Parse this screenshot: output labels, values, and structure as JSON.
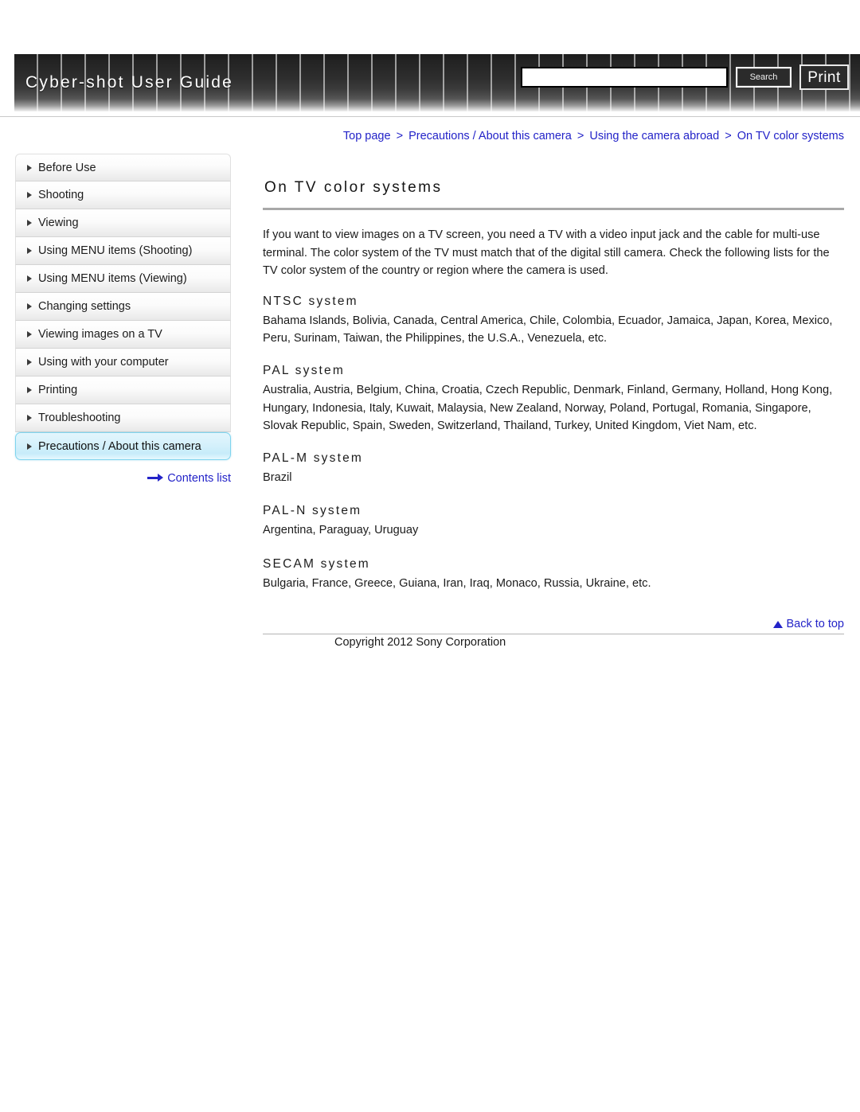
{
  "header": {
    "title": "Cyber-shot User Guide",
    "search": {
      "value": "",
      "placeholder": "",
      "button_label": "Search",
      "icon": "search-icon"
    },
    "print_label": "Print"
  },
  "breadcrumb": {
    "items": [
      "Top page",
      "Precautions / About this camera",
      "Using the camera abroad",
      "On TV color systems"
    ],
    "separator": ">",
    "full_text": "Top page > Precautions / About this camera > Using the camera abroad > On TV color systems"
  },
  "sidebar": {
    "items": [
      {
        "label": "Before Use",
        "active": false
      },
      {
        "label": "Shooting",
        "active": false
      },
      {
        "label": "Viewing",
        "active": false
      },
      {
        "label": "Using MENU items (Shooting)",
        "active": false
      },
      {
        "label": "Using MENU items (Viewing)",
        "active": false
      },
      {
        "label": "Changing settings",
        "active": false
      },
      {
        "label": "Viewing images on a TV",
        "active": false
      },
      {
        "label": "Using with your computer",
        "active": false
      },
      {
        "label": "Printing",
        "active": false
      },
      {
        "label": "Troubleshooting",
        "active": false
      },
      {
        "label": "Precautions / About this camera",
        "active": true
      }
    ],
    "contents_list_label": "Contents list",
    "contents_list_icon": "arrow-right-icon"
  },
  "main": {
    "title": "On TV color systems",
    "intro": "If you want to view images on a TV screen, you need a TV with a video input jack and the cable for multi-use terminal. The color system of the TV must match that of the digital still camera. Check the following lists for the TV color system of the country or region where the camera is used.",
    "sections": [
      {
        "heading": "NTSC system",
        "body": "Bahama Islands, Bolivia, Canada, Central America, Chile, Colombia, Ecuador, Jamaica, Japan, Korea, Mexico, Peru, Surinam, Taiwan, the Philippines, the U.S.A., Venezuela, etc."
      },
      {
        "heading": "PAL system",
        "body": "Australia, Austria, Belgium, China, Croatia, Czech Republic, Denmark, Finland, Germany, Holland, Hong Kong, Hungary, Indonesia, Italy, Kuwait, Malaysia, New Zealand, Norway, Poland, Portugal, Romania, Singapore, Slovak Republic, Spain, Sweden, Switzerland, Thailand, Turkey, United Kingdom, Viet Nam, etc."
      },
      {
        "heading": "PAL-M system",
        "body": "Brazil"
      },
      {
        "heading": "PAL-N system",
        "body": "Argentina, Paraguay, Uruguay"
      },
      {
        "heading": "SECAM system",
        "body": "Bulgaria, France, Greece, Guiana, Iran, Iraq, Monaco, Russia, Ukraine, etc."
      }
    ]
  },
  "footer": {
    "back_to_top_label": "Back to top",
    "back_to_top_icon": "triangle-up-icon",
    "copyright": "Copyright 2012 Sony Corporation"
  },
  "colors": {
    "link": "#2323c8",
    "active_nav_bg": "#d3f0fb",
    "active_nav_border": "#7fd4ee",
    "header_dark": "#222222",
    "rule": "#a8a8a8"
  }
}
